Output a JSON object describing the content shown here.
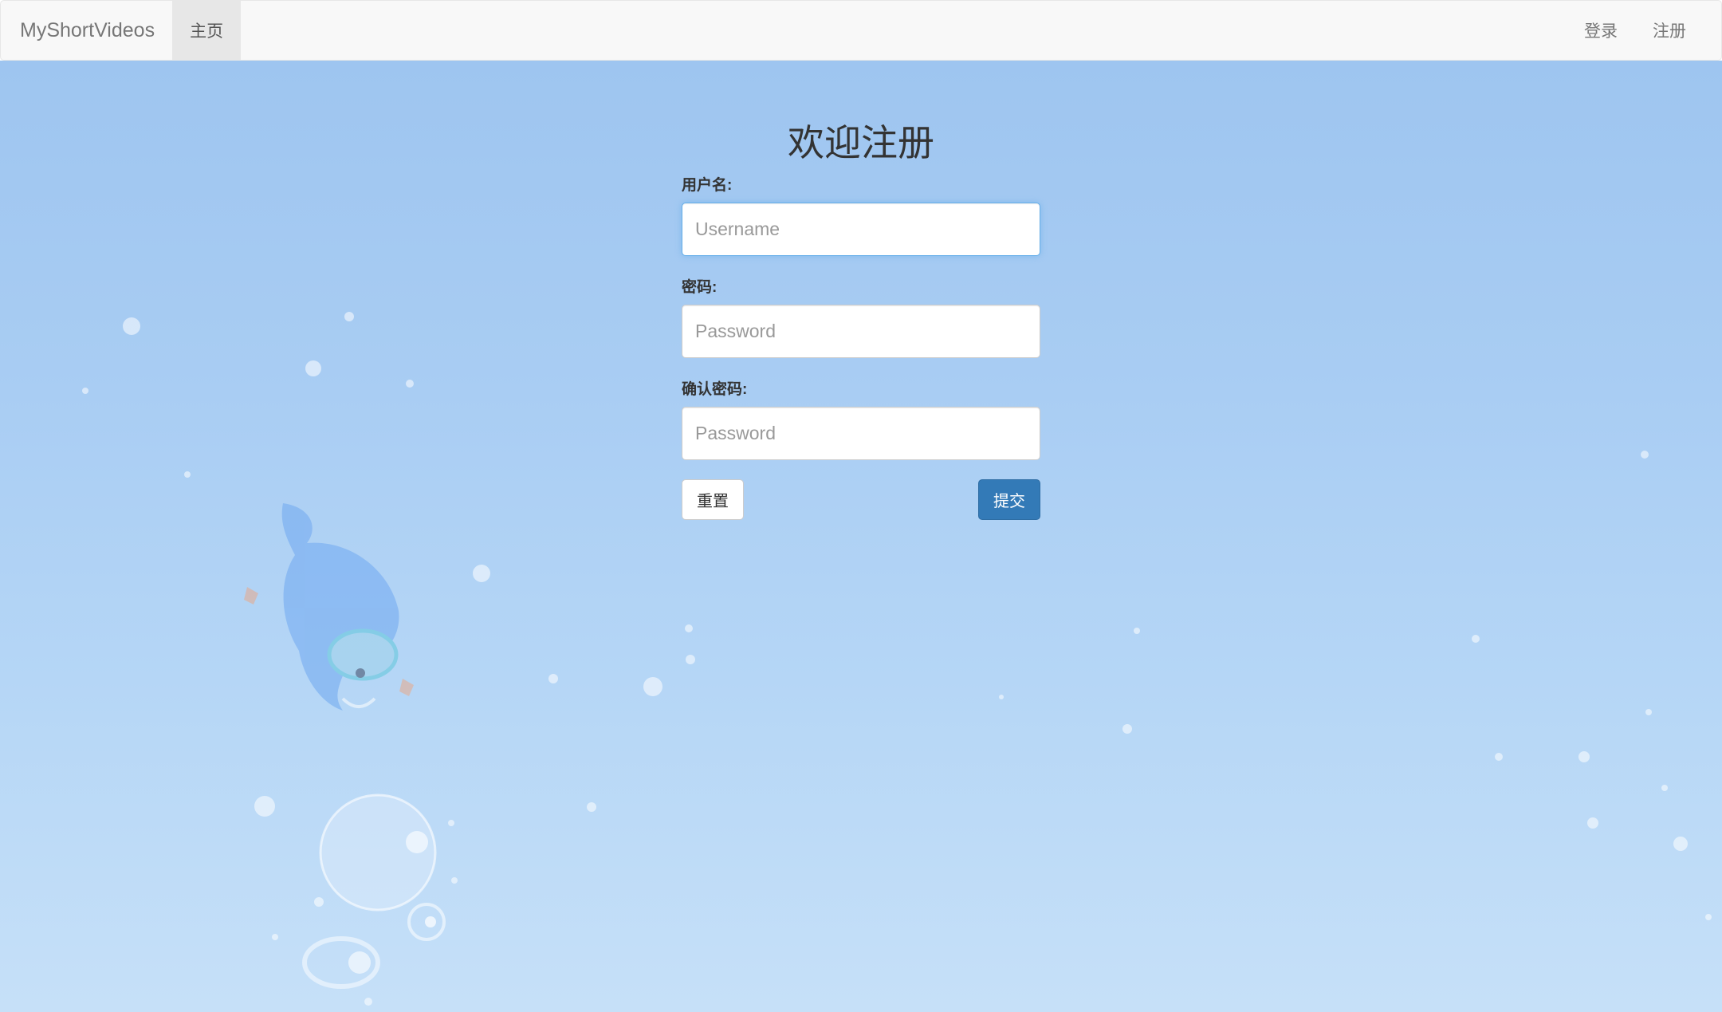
{
  "navbar": {
    "brand": "MyShortVideos",
    "home": "主页",
    "login": "登录",
    "register": "注册"
  },
  "form": {
    "title": "欢迎注册",
    "username_label": "用户名:",
    "username_placeholder": "Username",
    "password_label": "密码:",
    "password_placeholder": "Password",
    "confirm_label": "确认密码:",
    "confirm_placeholder": "Password",
    "reset_label": "重置",
    "submit_label": "提交"
  },
  "colors": {
    "primary": "#337ab7",
    "background_top": "#9ec5f0",
    "background_bottom": "#c6e0f8"
  },
  "background_icons": [
    "bubble-icon",
    "diver-dolphin-illustration"
  ]
}
